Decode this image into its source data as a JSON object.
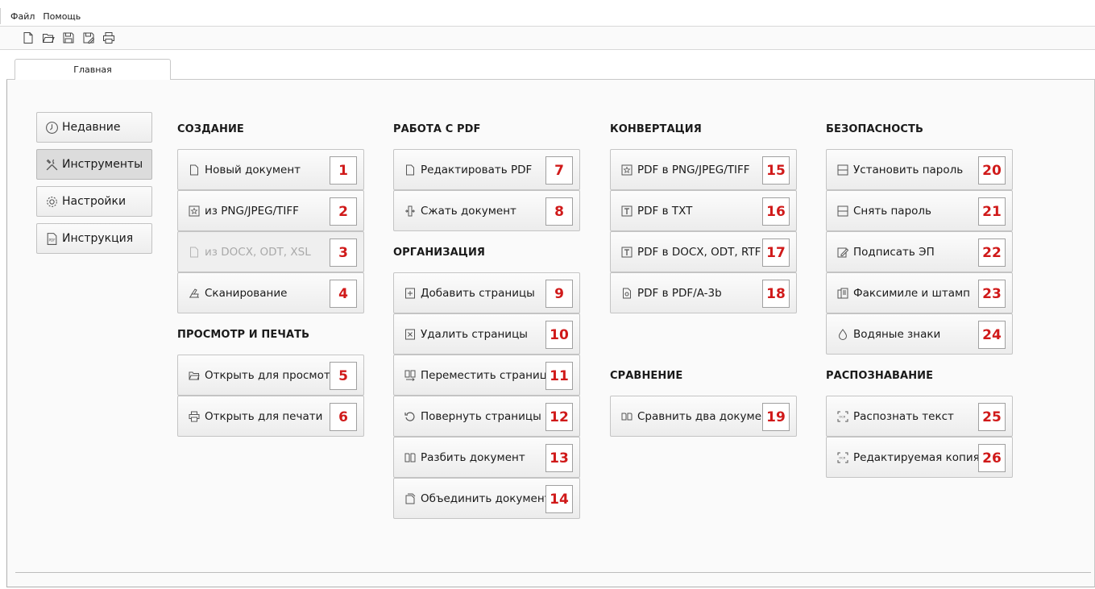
{
  "menu": {
    "file": "Файл",
    "help": "Помощь"
  },
  "toolbar": {
    "icons": [
      "new-file-icon",
      "open-folder-icon",
      "save-icon",
      "save-as-icon",
      "print-icon"
    ]
  },
  "tabs": [
    {
      "label": "Главная"
    }
  ],
  "sidebar": {
    "items": [
      {
        "label": "Недавние",
        "icon": "clock-icon"
      },
      {
        "label": "Инструменты",
        "icon": "tools-icon",
        "active": true
      },
      {
        "label": "Настройки",
        "icon": "gear-icon"
      },
      {
        "label": "Инструкция",
        "icon": "pdf-manual-icon"
      }
    ]
  },
  "sections": {
    "create": {
      "title": "СОЗДАНИЕ",
      "items": [
        {
          "label": "Новый документ",
          "num": "1"
        },
        {
          "label": "из PNG/JPEG/TIFF",
          "num": "2"
        },
        {
          "label": "из DOCX, ODT, XSL",
          "num": "3",
          "disabled": true
        },
        {
          "label": "Сканирование",
          "num": "4"
        }
      ]
    },
    "view_print": {
      "title": "ПРОСМОТР И ПЕЧАТЬ",
      "items": [
        {
          "label": "Открыть для просмотра",
          "num": "5"
        },
        {
          "label": "Открыть для печати",
          "num": "6"
        }
      ]
    },
    "pdf_work": {
      "title": "РАБОТА С PDF",
      "items": [
        {
          "label": "Редактировать PDF",
          "num": "7"
        },
        {
          "label": "Сжать документ",
          "num": "8"
        }
      ]
    },
    "organize": {
      "title": "ОРГАНИЗАЦИЯ",
      "items": [
        {
          "label": "Добавить страницы",
          "num": "9"
        },
        {
          "label": "Удалить страницы",
          "num": "10"
        },
        {
          "label": "Переместить страницы",
          "num": "11"
        },
        {
          "label": "Повернуть страницы",
          "num": "12"
        },
        {
          "label": "Разбить документ",
          "num": "13"
        },
        {
          "label": "Объединить документы",
          "num": "14"
        }
      ]
    },
    "convert": {
      "title": "КОНВЕРТАЦИЯ",
      "items": [
        {
          "label": "PDF в PNG/JPEG/TIFF",
          "num": "15"
        },
        {
          "label": "PDF в TXT",
          "num": "16"
        },
        {
          "label": "PDF в DOCX, ODT, RTF",
          "num": "17"
        },
        {
          "label": "PDF в PDF/A-3b",
          "num": "18"
        }
      ]
    },
    "compare": {
      "title": "СРАВНЕНИЕ",
      "items": [
        {
          "label": "Сравнить два документа",
          "num": "19"
        }
      ]
    },
    "security": {
      "title": "БЕЗОПАСНОСТЬ",
      "items": [
        {
          "label": "Установить пароль",
          "num": "20"
        },
        {
          "label": "Снять пароль",
          "num": "21"
        },
        {
          "label": "Подписать ЭП",
          "num": "22"
        },
        {
          "label": "Факсимиле и штамп",
          "num": "23"
        },
        {
          "label": "Водяные знаки",
          "num": "24"
        }
      ]
    },
    "ocr": {
      "title": "РАСПОЗНАВАНИЕ",
      "items": [
        {
          "label": "Распознать текст",
          "num": "25"
        },
        {
          "label": "Редактируемая копия",
          "num": "26"
        }
      ]
    }
  }
}
